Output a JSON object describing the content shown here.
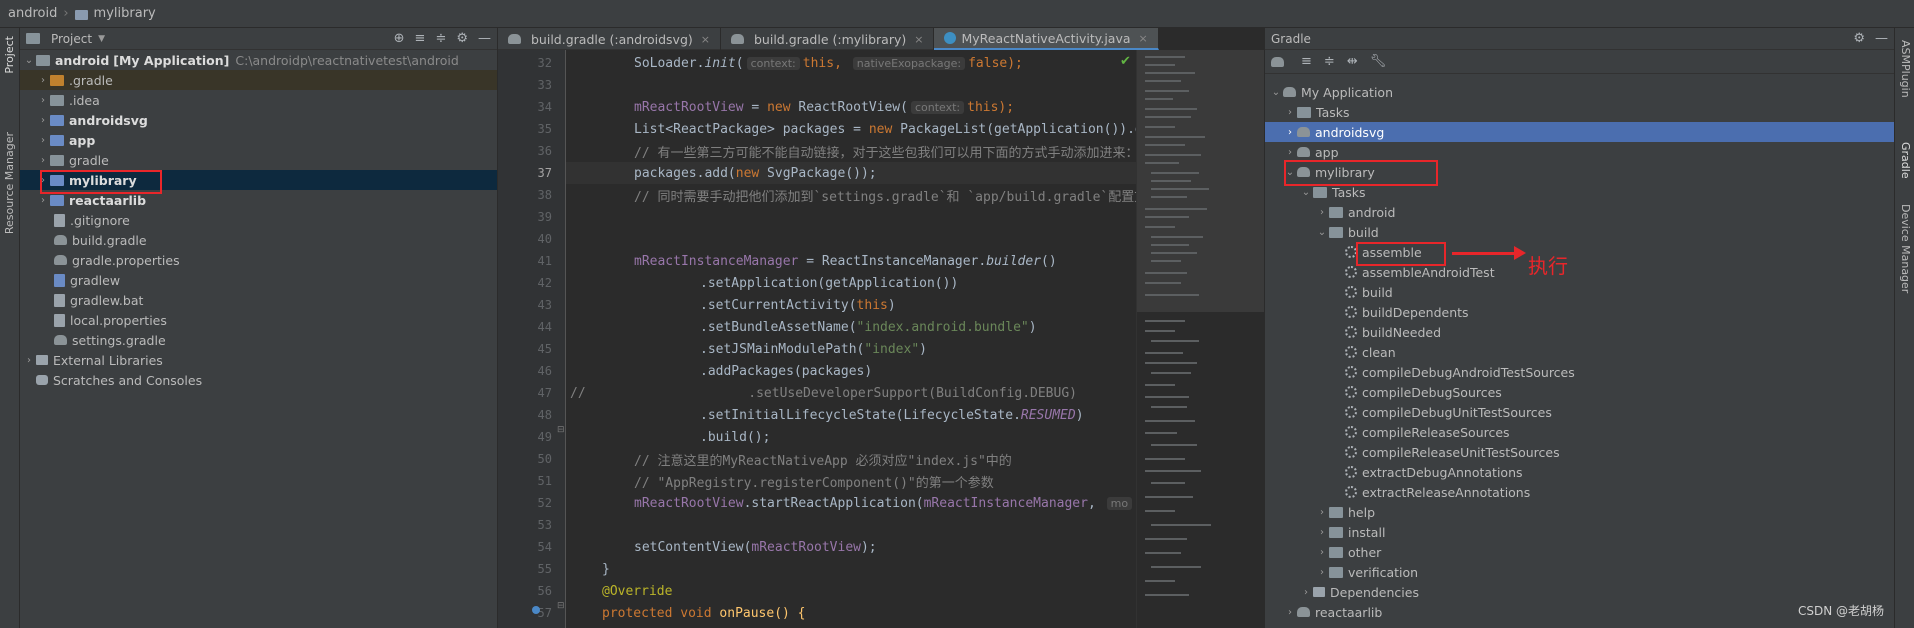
{
  "breadcrumb": {
    "root": "android",
    "child": "mylibrary"
  },
  "left_strip": {
    "project": "Project",
    "resource_manager": "Resource Manager"
  },
  "right_strip": {
    "asm": "ASMPlugin",
    "gradle": "Gradle",
    "device_manager": "Device Manager"
  },
  "project_panel": {
    "title": "Project",
    "root_name": "android",
    "root_module": "[My Application]",
    "root_path": "C:\\androidp\\reactnativetest\\android",
    "items": [
      {
        "label": ".gradle"
      },
      {
        "label": ".idea"
      },
      {
        "label": "androidsvg"
      },
      {
        "label": "app"
      },
      {
        "label": "gradle"
      },
      {
        "label": "mylibrary"
      },
      {
        "label": "reactaarlib"
      },
      {
        "label": ".gitignore"
      },
      {
        "label": "build.gradle"
      },
      {
        "label": "gradle.properties"
      },
      {
        "label": "gradlew"
      },
      {
        "label": "gradlew.bat"
      },
      {
        "label": "local.properties"
      },
      {
        "label": "settings.gradle"
      },
      {
        "label": "External Libraries"
      },
      {
        "label": "Scratches and Consoles"
      }
    ]
  },
  "editor_tabs": [
    {
      "label": "build.gradle (:androidsvg)"
    },
    {
      "label": "build.gradle (:mylibrary)"
    },
    {
      "label": "MyReactNativeActivity.java"
    }
  ],
  "editor": {
    "line_numbers": [
      "32",
      "33",
      "34",
      "35",
      "36",
      "37",
      "38",
      "39",
      "40",
      "41",
      "42",
      "43",
      "44",
      "45",
      "46",
      "47",
      "48",
      "49",
      "50",
      "51",
      "52",
      "53",
      "54",
      "55",
      "56",
      "57"
    ],
    "hints": {
      "context": "context:",
      "native_exo": "nativeExopackage:",
      "context2": "context:",
      "mo": "mo"
    },
    "l32": {
      "a": "SoLoader.",
      "b": "init",
      "c": "(",
      "d": "this, ",
      "e": "false);"
    },
    "l34": {
      "a": "mReactRootView",
      "b": " = ",
      "c": "new",
      "d": " ReactRootView(",
      "e": "this);"
    },
    "l35": {
      "a": "List<ReactPackage> packages = ",
      "b": "new",
      "c": " PackageList(getApplication()).getPackages();"
    },
    "l36": "// 有一些第三方可能不能自动链接，对于这些包我们可以用下面的方式手动添加进来：",
    "l37": {
      "a": "packages.add(",
      "b": "new",
      "c": " SvgPackage());"
    },
    "l38": "// 同时需要手动把他们添加到`settings.gradle`和 `app/build.gradle`配置文件中。",
    "l41": {
      "a": "mReactInstanceManager",
      "b": " = ReactInstanceManager.",
      "c": "builder",
      "d": "()"
    },
    "l42": ".setApplication(getApplication())",
    "l43": {
      "a": ".setCurrentActivity(",
      "b": "this",
      "c": ")"
    },
    "l44": {
      "a": ".setBundleAssetName(",
      "b": "\"index.android.bundle\"",
      "c": ")"
    },
    "l45": {
      "a": ".setJSMainModulePath(",
      "b": "\"index\"",
      "c": ")"
    },
    "l46": ".addPackages(packages)",
    "l47": {
      "a": "//",
      "b": "        .setUseDeveloperSupport(BuildConfig.DEBUG)"
    },
    "l48": {
      "a": ".setInitialLifecycleState(LifecycleState.",
      "b": "RESUMED",
      "c": ")"
    },
    "l49": ".build();",
    "l50": "// 注意这里的MyReactNativeApp 必须对应\"index.js\"中的",
    "l51": "// \"AppRegistry.registerComponent()\"的第一个参数",
    "l52": {
      "a": "mReactRootView",
      "b": ".startReactApplication(",
      "c": "mReactInstanceManager",
      "d": ", "
    },
    "l54": {
      "a": "setContentView(",
      "b": "mReactRootView",
      "c": ");"
    },
    "l55": "}",
    "l56": "@Override",
    "l57": {
      "a": "protected",
      "b": " ",
      "c": "void",
      "d": " onPause() {"
    }
  },
  "gradle_panel": {
    "title": "Gradle",
    "items": [
      {
        "label": "My Application"
      },
      {
        "label": "Tasks"
      },
      {
        "label": "androidsvg"
      },
      {
        "label": "app"
      },
      {
        "label": "mylibrary"
      },
      {
        "label": "Tasks"
      },
      {
        "label": "android"
      },
      {
        "label": "build"
      },
      {
        "label": "assemble"
      },
      {
        "label": "assembleAndroidTest"
      },
      {
        "label": "build"
      },
      {
        "label": "buildDependents"
      },
      {
        "label": "buildNeeded"
      },
      {
        "label": "clean"
      },
      {
        "label": "compileDebugAndroidTestSources"
      },
      {
        "label": "compileDebugSources"
      },
      {
        "label": "compileDebugUnitTestSources"
      },
      {
        "label": "compileReleaseSources"
      },
      {
        "label": "compileReleaseUnitTestSources"
      },
      {
        "label": "extractDebugAnnotations"
      },
      {
        "label": "extractReleaseAnnotations"
      },
      {
        "label": "help"
      },
      {
        "label": "install"
      },
      {
        "label": "other"
      },
      {
        "label": "verification"
      },
      {
        "label": "Dependencies"
      },
      {
        "label": "reactaarlib"
      }
    ]
  },
  "annotation": {
    "label": "执行"
  },
  "watermark": "CSDN @老胡杨",
  "colors": {
    "accent": "#4a88c7",
    "selection": "#4b6eaf",
    "highlight": "#e8262a"
  }
}
